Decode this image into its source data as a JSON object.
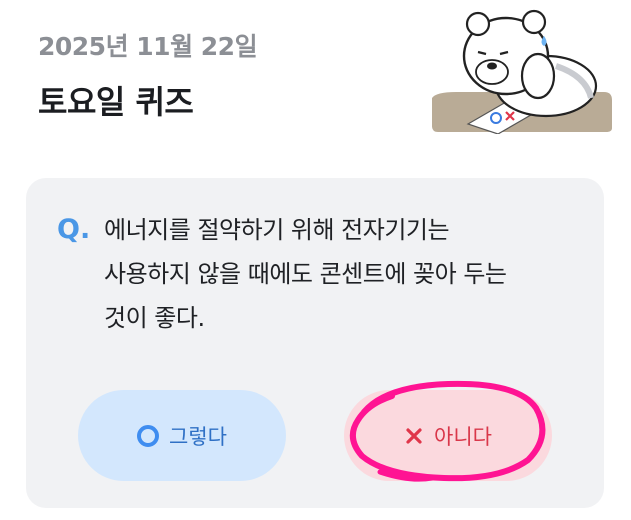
{
  "header": {
    "date": "2025년 11월 22일",
    "title": "토요일 퀴즈"
  },
  "quiz": {
    "q_label": "Q.",
    "question_lines": [
      "에너지를 절약하기 위해 전자기기는",
      "사용하지 않을 때에도 콘센트에 꽂아 두는",
      "것이 좋다."
    ],
    "answers": {
      "yes_label": "그렇다",
      "no_label": "아니다"
    }
  },
  "colors": {
    "card_bg": "#f1f2f4",
    "accent_blue": "#4a97e6",
    "yes_button_bg": "#d3e7fd",
    "no_button_bg": "#fbd9de",
    "no_text": "#d9374a",
    "annotation": "#ff1493"
  },
  "icons": {
    "mascot": "sad-bear-mascot",
    "yes": "circle-o-icon",
    "no": "x-icon"
  }
}
